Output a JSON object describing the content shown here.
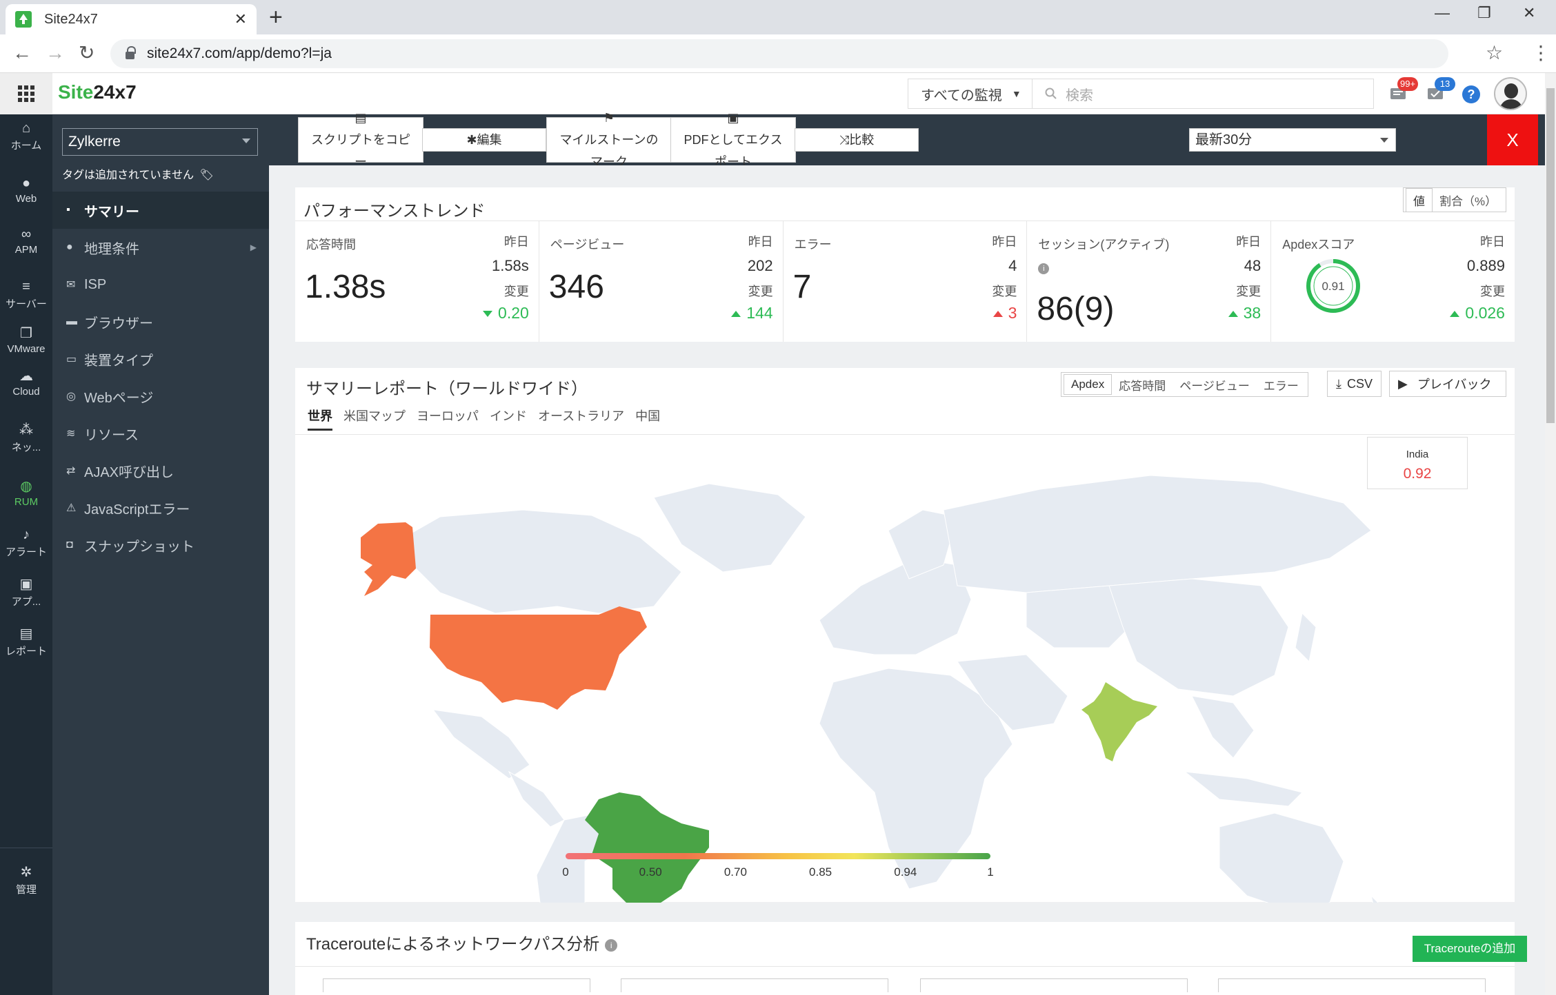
{
  "browser": {
    "tab_title": "Site24x7",
    "url": "site24x7.com/app/demo?l=ja"
  },
  "header": {
    "logo_green": "Site",
    "logo_dark": "24x7",
    "monitor_filter": "すべての監視",
    "search_placeholder": "検索",
    "alerts_badge": "99+",
    "tasks_badge": "13",
    "help": "?"
  },
  "rail": [
    {
      "label": "ホーム",
      "icon": "home-icon",
      "glyph": "⌂"
    },
    {
      "label": "Web",
      "icon": "globe-icon",
      "glyph": "●"
    },
    {
      "label": "APM",
      "icon": "binoculars-icon",
      "glyph": "∞"
    },
    {
      "label": "サーバー",
      "icon": "server-icon",
      "glyph": "≡"
    },
    {
      "label": "VMware",
      "icon": "vmware-icon",
      "glyph": "❐"
    },
    {
      "label": "Cloud",
      "icon": "cloud-icon",
      "glyph": "☁"
    },
    {
      "label": "ネッ...",
      "icon": "network-icon",
      "glyph": "⁂"
    },
    {
      "label": "RUM",
      "icon": "rum-globe-icon",
      "glyph": "◍"
    },
    {
      "label": "アラート",
      "icon": "bell-icon",
      "glyph": "♪"
    },
    {
      "label": "アプ...",
      "icon": "app-icon",
      "glyph": "▣"
    },
    {
      "label": "レポート",
      "icon": "report-icon",
      "glyph": "▤"
    },
    {
      "label": "管理",
      "icon": "gear-icon",
      "glyph": "✲"
    }
  ],
  "nav": {
    "monitor": "Zylkerre",
    "no_tags": "タグは追加されていません",
    "items": [
      {
        "label": "サマリー",
        "glyph": "▪"
      },
      {
        "label": "地理条件",
        "glyph": "●"
      },
      {
        "label": "ISP",
        "glyph": "✉"
      },
      {
        "label": "ブラウザー",
        "glyph": "▬"
      },
      {
        "label": "装置タイプ",
        "glyph": "▭"
      },
      {
        "label": "Webページ",
        "glyph": "◎"
      },
      {
        "label": "リソース",
        "glyph": "≋"
      },
      {
        "label": "AJAX呼び出し",
        "glyph": "⇄"
      },
      {
        "label": "JavaScriptエラー",
        "glyph": "⚠"
      },
      {
        "label": "スナップショット",
        "glyph": "◘"
      }
    ]
  },
  "toolbar": {
    "copy_script": "スクリプトをコピー",
    "edit": "編集",
    "milestone": "マイルストーンのマーク",
    "export_pdf": "PDFとしてエクスポート",
    "compare": "比較",
    "time_range": "最新30分",
    "close": "X"
  },
  "performance": {
    "title": "パフォーマンストレンド",
    "toggle_value": "値",
    "toggle_percent": "割合（%）",
    "yesterday_label": "昨日",
    "change_label": "変更",
    "metrics": [
      {
        "label": "応答時間",
        "value": "1.38s",
        "yesterday": "1.58s",
        "change": "0.20",
        "direction": "down"
      },
      {
        "label": "ページビュー",
        "value": "346",
        "yesterday": "202",
        "change": "144",
        "direction": "up"
      },
      {
        "label": "エラー",
        "value": "7",
        "yesterday": "4",
        "change": "3",
        "direction": "up-bad"
      },
      {
        "label": "セッション(アクティブ)",
        "value": "86(9)",
        "yesterday": "48",
        "change": "38",
        "direction": "up"
      },
      {
        "label": "Apdexスコア",
        "value": "0.91",
        "yesterday": "0.889",
        "change": "0.026",
        "direction": "up"
      }
    ]
  },
  "summary": {
    "title": "サマリーレポート（ワールドワイド）",
    "metric_tabs": [
      "Apdex",
      "応答時間",
      "ページビュー",
      "エラー"
    ],
    "csv": "CSV",
    "playback": "プレイバック",
    "region_tabs": [
      "世界",
      "米国マップ",
      "ヨーロッパ",
      "インド",
      "オーストラリア",
      "中国"
    ],
    "hover_country": "India",
    "hover_value": "0.92",
    "legend_ticks": [
      "0",
      "0.50",
      "0.70",
      "0.85",
      "0.94",
      "1"
    ],
    "colors": {
      "land": "#e6ebf2",
      "usa": "#f47444",
      "alaska": "#f47444",
      "brazil": "#4aa446",
      "india": "#a7cd57"
    }
  },
  "traceroute": {
    "title": "Tracerouteによるネットワークパス分析",
    "add_button": "Tracerouteの追加"
  }
}
